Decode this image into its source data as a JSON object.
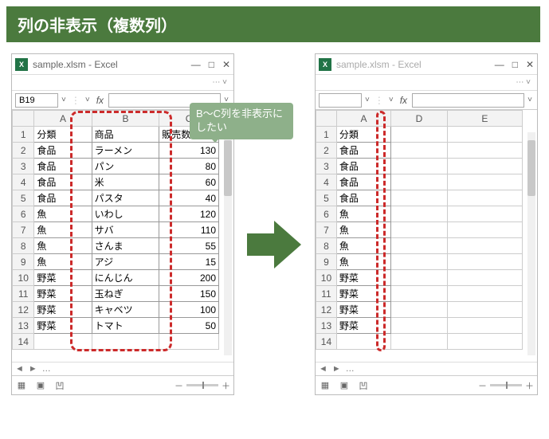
{
  "banner_title": "列の非表示（複数列）",
  "callout_text": "B～C列を非表示にしたい",
  "arrow_label": "arrow-right",
  "left_window": {
    "title": "sample.xlsm - Excel",
    "namebox": "B19",
    "fx_label": "fx",
    "col_headers": [
      "A",
      "B",
      "C"
    ],
    "row_headers": [
      "1",
      "2",
      "3",
      "4",
      "5",
      "6",
      "7",
      "8",
      "9",
      "10",
      "11",
      "12",
      "13",
      "14"
    ],
    "rows": [
      {
        "a": "分類",
        "b": "商品",
        "c": "販売数"
      },
      {
        "a": "食品",
        "b": "ラーメン",
        "c": "130"
      },
      {
        "a": "食品",
        "b": "パン",
        "c": "80"
      },
      {
        "a": "食品",
        "b": "米",
        "c": "60"
      },
      {
        "a": "食品",
        "b": "パスタ",
        "c": "40"
      },
      {
        "a": "魚",
        "b": "いわし",
        "c": "120"
      },
      {
        "a": "魚",
        "b": "サバ",
        "c": "110"
      },
      {
        "a": "魚",
        "b": "さんま",
        "c": "55"
      },
      {
        "a": "魚",
        "b": "アジ",
        "c": "15"
      },
      {
        "a": "野菜",
        "b": "にんじん",
        "c": "200"
      },
      {
        "a": "野菜",
        "b": "玉ねぎ",
        "c": "150"
      },
      {
        "a": "野菜",
        "b": "キャベツ",
        "c": "100"
      },
      {
        "a": "野菜",
        "b": "トマト",
        "c": "50"
      },
      {
        "a": "",
        "b": "",
        "c": ""
      }
    ]
  },
  "right_window": {
    "title": "sample.xlsm - Excel",
    "namebox": "",
    "fx_label": "fx",
    "col_headers": [
      "A",
      "D",
      "E"
    ],
    "row_headers": [
      "1",
      "2",
      "3",
      "4",
      "5",
      "6",
      "7",
      "8",
      "9",
      "10",
      "11",
      "12",
      "13",
      "14"
    ],
    "rows": [
      {
        "a": "分類",
        "d": "",
        "e": ""
      },
      {
        "a": "食品",
        "d": "",
        "e": ""
      },
      {
        "a": "食品",
        "d": "",
        "e": ""
      },
      {
        "a": "食品",
        "d": "",
        "e": ""
      },
      {
        "a": "食品",
        "d": "",
        "e": ""
      },
      {
        "a": "魚",
        "d": "",
        "e": ""
      },
      {
        "a": "魚",
        "d": "",
        "e": ""
      },
      {
        "a": "魚",
        "d": "",
        "e": ""
      },
      {
        "a": "魚",
        "d": "",
        "e": ""
      },
      {
        "a": "野菜",
        "d": "",
        "e": ""
      },
      {
        "a": "野菜",
        "d": "",
        "e": ""
      },
      {
        "a": "野菜",
        "d": "",
        "e": ""
      },
      {
        "a": "野菜",
        "d": "",
        "e": ""
      },
      {
        "a": "",
        "d": "",
        "e": ""
      }
    ]
  },
  "winbtns": {
    "min": "—",
    "max": "□",
    "close": "✕"
  },
  "statusbar": {
    "minus": "－",
    "plus": "＋"
  }
}
